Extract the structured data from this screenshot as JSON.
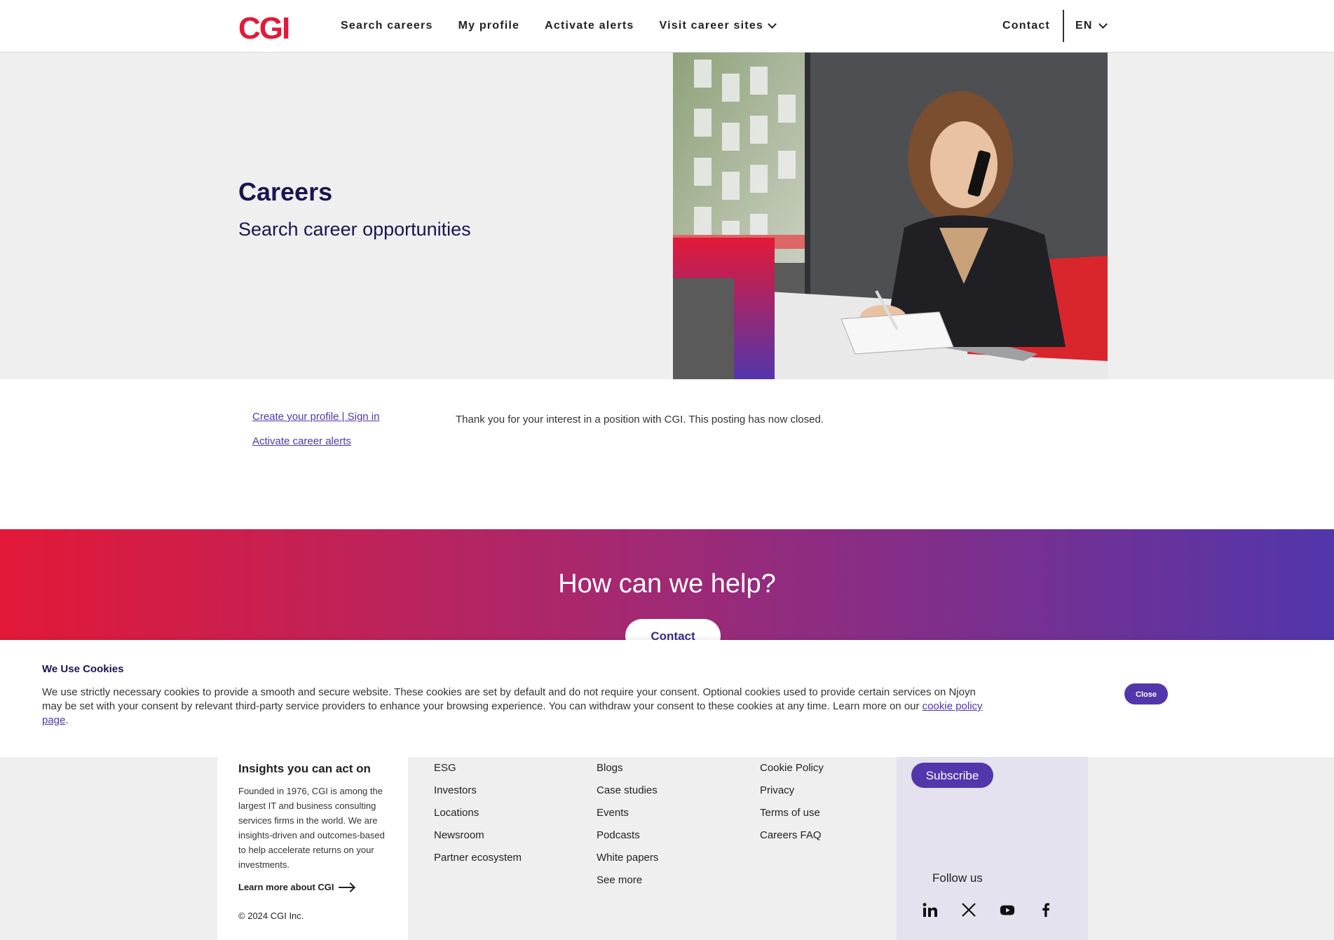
{
  "header": {
    "logo": "CGI",
    "nav": [
      {
        "label": "Search careers"
      },
      {
        "label": "My profile"
      },
      {
        "label": "Activate alerts"
      },
      {
        "label": "Visit career sites"
      }
    ],
    "contact_label": "Contact",
    "lang_label": "EN"
  },
  "hero": {
    "title": "Careers",
    "subtitle": "Search career opportunities"
  },
  "content": {
    "side_links": [
      "Create your profile | Sign in",
      "Activate career alerts"
    ],
    "message": "Thank you for your interest in a position with CGI. This posting has now closed."
  },
  "help": {
    "title": "How can we help?",
    "button": "Contact"
  },
  "cookies": {
    "title": "We Use Cookies",
    "text_before": "We use strictly necessary cookies to provide a smooth and secure website. These cookies are set by default and do not require your consent. Optional cookies used to provide certain services on Njoyn may be set with your consent by relevant third-party service providers to enhance your browsing experience. You can withdraw your consent to these cookies at any time. Learn more on our ",
    "link_text": "cookie policy page",
    "text_after": ".",
    "close_label": "Close"
  },
  "footer": {
    "about_title": "Insights you can act on",
    "about_text": "Founded in 1976, CGI is among the largest IT and business consulting services firms in the world. We are insights-driven and outcomes-based to help accelerate returns on your investments.",
    "learn_more": "Learn more about CGI",
    "copyright": "© 2024 CGI Inc.",
    "col1": [
      "ESG",
      "Investors",
      "Locations",
      "Newsroom",
      "Partner ecosystem"
    ],
    "col2": [
      "Blogs",
      "Case studies",
      "Events",
      "Podcasts",
      "White papers",
      "See more"
    ],
    "col3": [
      "Cookie Policy",
      "Privacy",
      "Terms of use",
      "Careers FAQ"
    ],
    "subscribe_label": "Subscribe",
    "follow_label": "Follow us",
    "social_icons": [
      "linkedin-icon",
      "x-icon",
      "youtube-icon",
      "facebook-icon"
    ]
  },
  "colors": {
    "brand_red": "#e31937",
    "brand_purple": "#5236ab",
    "dark_navy": "#1a1550"
  }
}
